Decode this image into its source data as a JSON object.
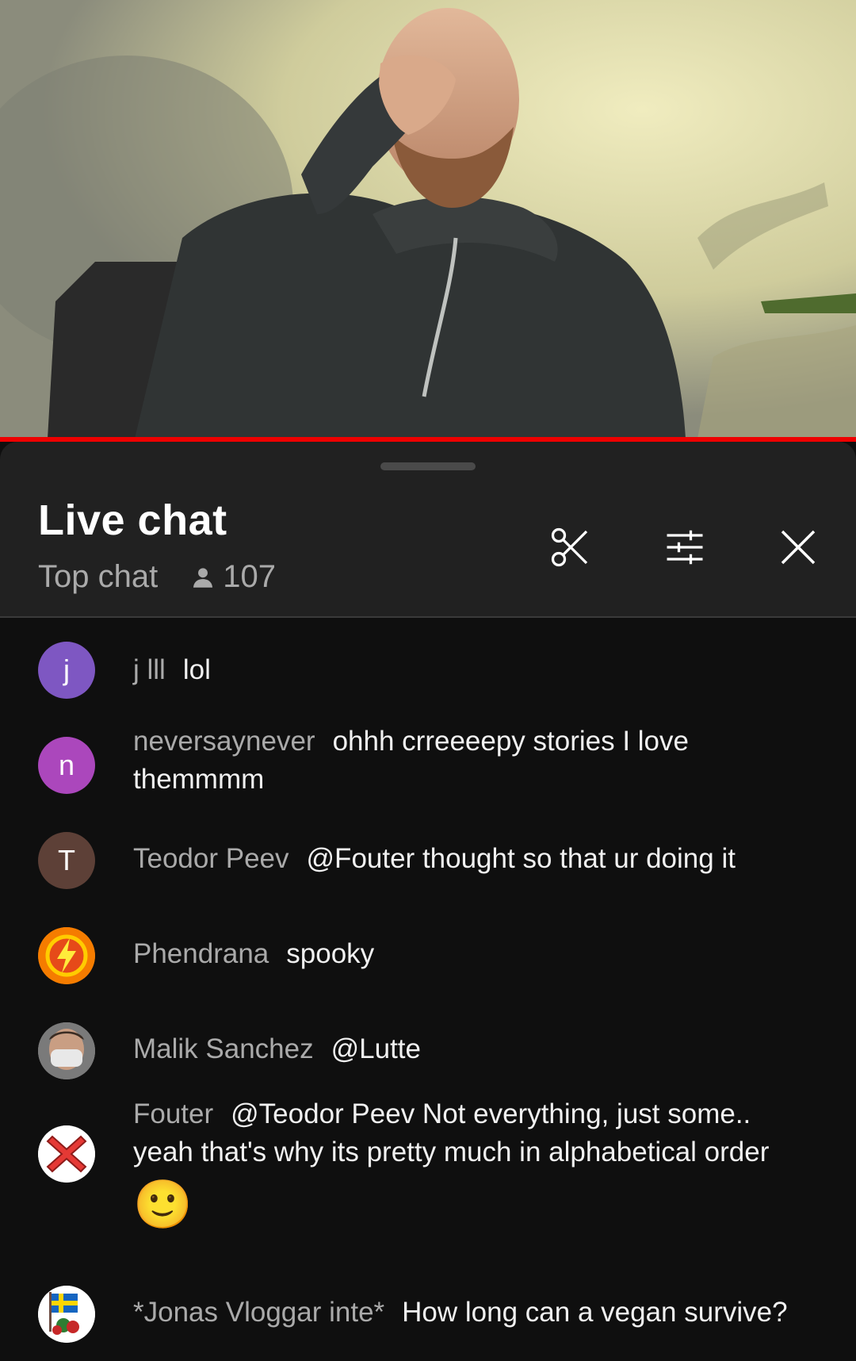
{
  "header": {
    "title": "Live chat",
    "mode": "Top chat",
    "viewer_count": "107",
    "icons": [
      "scissors-icon",
      "tune-icon",
      "close-icon"
    ]
  },
  "messages": [
    {
      "avatar_letter": "j",
      "avatar_color": "#7e57c2",
      "author": "j lll",
      "text": "lol"
    },
    {
      "avatar_letter": "n",
      "avatar_color": "#ab47bc",
      "author": "neversaynever",
      "text": "ohhh crreeeepy stories I love themmmm"
    },
    {
      "avatar_letter": "T",
      "avatar_color": "#5d4037",
      "author": "Teodor Peev",
      "text": "@Fouter thought so that ur doing it"
    },
    {
      "avatar_letter": "",
      "avatar_color": "#f57c00",
      "author": "Phendrana",
      "text": "spooky"
    },
    {
      "avatar_letter": "",
      "avatar_color": "#9e9e9e",
      "author": "Malik Sanchez",
      "text": "@Lutte"
    },
    {
      "avatar_letter": "",
      "avatar_color": "#ffffff",
      "author": "Fouter",
      "text": "@Teodor Peev Not everything, just some.. yeah that's why its pretty much in alphabetical order",
      "emoji": "🙂"
    },
    {
      "avatar_letter": "",
      "avatar_color": "#ffffff",
      "author": "*Jonas Vloggar inte*",
      "text": "How long can a vegan survive?"
    }
  ]
}
